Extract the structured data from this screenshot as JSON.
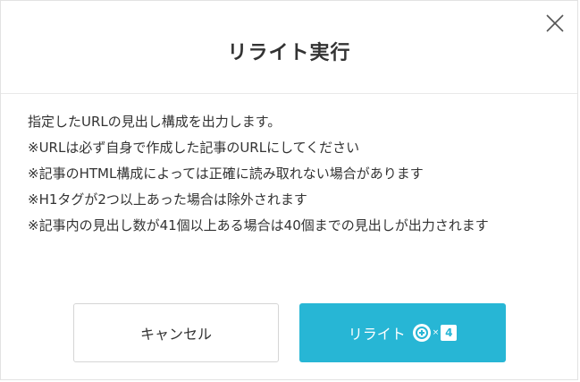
{
  "dialog": {
    "title": "リライト実行",
    "description": [
      "指定したURLの見出し構成を出力します。",
      "※URLは必ず自身で作成した記事のURLにしてください",
      "※記事のHTML構成によっては正確に読み取れない場合があります",
      "※H1タグが2つ以上あった場合は除外されます",
      "※記事内の見出し数が41個以上ある場合は40個までの見出しが出力されます"
    ],
    "cancel_label": "キャンセル",
    "rewrite_label": "リライト",
    "credit_multiplier": "×",
    "credit_cost": "4"
  },
  "icons": {
    "close": "close-icon",
    "credit": "credit-coin-icon"
  },
  "colors": {
    "accent": "#27b6d5",
    "text": "#333333",
    "border": "#d5d5d5"
  }
}
